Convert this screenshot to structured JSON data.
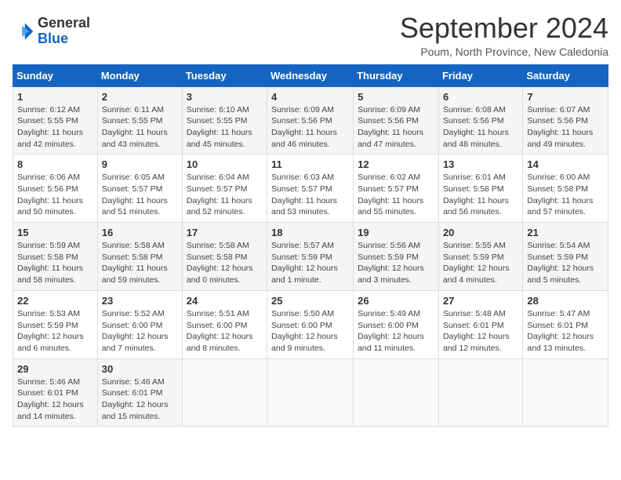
{
  "header": {
    "logo_general": "General",
    "logo_blue": "Blue",
    "month_year": "September 2024",
    "location": "Poum, North Province, New Caledonia"
  },
  "weekdays": [
    "Sunday",
    "Monday",
    "Tuesday",
    "Wednesday",
    "Thursday",
    "Friday",
    "Saturday"
  ],
  "weeks": [
    [
      {
        "day": "1",
        "sunrise": "6:12 AM",
        "sunset": "5:55 PM",
        "daylight": "11 hours and 42 minutes."
      },
      {
        "day": "2",
        "sunrise": "6:11 AM",
        "sunset": "5:55 PM",
        "daylight": "11 hours and 43 minutes."
      },
      {
        "day": "3",
        "sunrise": "6:10 AM",
        "sunset": "5:55 PM",
        "daylight": "11 hours and 45 minutes."
      },
      {
        "day": "4",
        "sunrise": "6:09 AM",
        "sunset": "5:56 PM",
        "daylight": "11 hours and 46 minutes."
      },
      {
        "day": "5",
        "sunrise": "6:09 AM",
        "sunset": "5:56 PM",
        "daylight": "11 hours and 47 minutes."
      },
      {
        "day": "6",
        "sunrise": "6:08 AM",
        "sunset": "5:56 PM",
        "daylight": "11 hours and 48 minutes."
      },
      {
        "day": "7",
        "sunrise": "6:07 AM",
        "sunset": "5:56 PM",
        "daylight": "11 hours and 49 minutes."
      }
    ],
    [
      {
        "day": "8",
        "sunrise": "6:06 AM",
        "sunset": "5:56 PM",
        "daylight": "11 hours and 50 minutes."
      },
      {
        "day": "9",
        "sunrise": "6:05 AM",
        "sunset": "5:57 PM",
        "daylight": "11 hours and 51 minutes."
      },
      {
        "day": "10",
        "sunrise": "6:04 AM",
        "sunset": "5:57 PM",
        "daylight": "11 hours and 52 minutes."
      },
      {
        "day": "11",
        "sunrise": "6:03 AM",
        "sunset": "5:57 PM",
        "daylight": "11 hours and 53 minutes."
      },
      {
        "day": "12",
        "sunrise": "6:02 AM",
        "sunset": "5:57 PM",
        "daylight": "11 hours and 55 minutes."
      },
      {
        "day": "13",
        "sunrise": "6:01 AM",
        "sunset": "5:58 PM",
        "daylight": "11 hours and 56 minutes."
      },
      {
        "day": "14",
        "sunrise": "6:00 AM",
        "sunset": "5:58 PM",
        "daylight": "11 hours and 57 minutes."
      }
    ],
    [
      {
        "day": "15",
        "sunrise": "5:59 AM",
        "sunset": "5:58 PM",
        "daylight": "11 hours and 58 minutes."
      },
      {
        "day": "16",
        "sunrise": "5:58 AM",
        "sunset": "5:58 PM",
        "daylight": "11 hours and 59 minutes."
      },
      {
        "day": "17",
        "sunrise": "5:58 AM",
        "sunset": "5:58 PM",
        "daylight": "12 hours and 0 minutes."
      },
      {
        "day": "18",
        "sunrise": "5:57 AM",
        "sunset": "5:59 PM",
        "daylight": "12 hours and 1 minute."
      },
      {
        "day": "19",
        "sunrise": "5:56 AM",
        "sunset": "5:59 PM",
        "daylight": "12 hours and 3 minutes."
      },
      {
        "day": "20",
        "sunrise": "5:55 AM",
        "sunset": "5:59 PM",
        "daylight": "12 hours and 4 minutes."
      },
      {
        "day": "21",
        "sunrise": "5:54 AM",
        "sunset": "5:59 PM",
        "daylight": "12 hours and 5 minutes."
      }
    ],
    [
      {
        "day": "22",
        "sunrise": "5:53 AM",
        "sunset": "5:59 PM",
        "daylight": "12 hours and 6 minutes."
      },
      {
        "day": "23",
        "sunrise": "5:52 AM",
        "sunset": "6:00 PM",
        "daylight": "12 hours and 7 minutes."
      },
      {
        "day": "24",
        "sunrise": "5:51 AM",
        "sunset": "6:00 PM",
        "daylight": "12 hours and 8 minutes."
      },
      {
        "day": "25",
        "sunrise": "5:50 AM",
        "sunset": "6:00 PM",
        "daylight": "12 hours and 9 minutes."
      },
      {
        "day": "26",
        "sunrise": "5:49 AM",
        "sunset": "6:00 PM",
        "daylight": "12 hours and 11 minutes."
      },
      {
        "day": "27",
        "sunrise": "5:48 AM",
        "sunset": "6:01 PM",
        "daylight": "12 hours and 12 minutes."
      },
      {
        "day": "28",
        "sunrise": "5:47 AM",
        "sunset": "6:01 PM",
        "daylight": "12 hours and 13 minutes."
      }
    ],
    [
      {
        "day": "29",
        "sunrise": "5:46 AM",
        "sunset": "6:01 PM",
        "daylight": "12 hours and 14 minutes."
      },
      {
        "day": "30",
        "sunrise": "5:46 AM",
        "sunset": "6:01 PM",
        "daylight": "12 hours and 15 minutes."
      },
      null,
      null,
      null,
      null,
      null
    ]
  ],
  "labels": {
    "sunrise": "Sunrise: ",
    "sunset": "Sunset: ",
    "daylight": "Daylight: "
  }
}
